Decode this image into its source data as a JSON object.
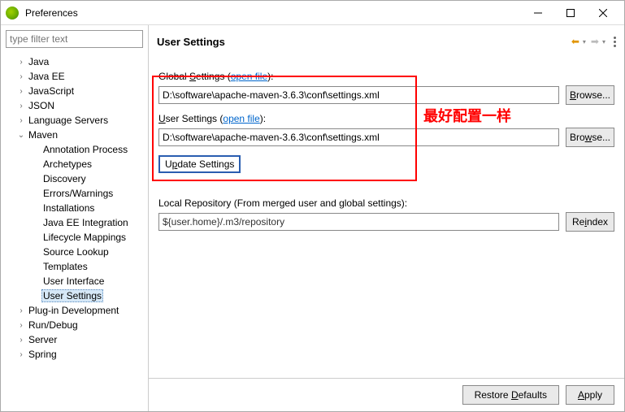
{
  "window": {
    "title": "Preferences"
  },
  "sidebar": {
    "filter_placeholder": "type filter text",
    "items": [
      {
        "label": "Java",
        "expandable": true,
        "expanded": false,
        "indent": 1
      },
      {
        "label": "Java EE",
        "expandable": true,
        "expanded": false,
        "indent": 1
      },
      {
        "label": "JavaScript",
        "expandable": true,
        "expanded": false,
        "indent": 1
      },
      {
        "label": "JSON",
        "expandable": true,
        "expanded": false,
        "indent": 1
      },
      {
        "label": "Language Servers",
        "expandable": true,
        "expanded": false,
        "indent": 1
      },
      {
        "label": "Maven",
        "expandable": true,
        "expanded": true,
        "indent": 1
      },
      {
        "label": "Annotation Process",
        "expandable": false,
        "indent": 2
      },
      {
        "label": "Archetypes",
        "expandable": false,
        "indent": 2
      },
      {
        "label": "Discovery",
        "expandable": false,
        "indent": 2
      },
      {
        "label": "Errors/Warnings",
        "expandable": false,
        "indent": 2
      },
      {
        "label": "Installations",
        "expandable": false,
        "indent": 2
      },
      {
        "label": "Java EE Integration",
        "expandable": false,
        "indent": 2
      },
      {
        "label": "Lifecycle Mappings",
        "expandable": false,
        "indent": 2
      },
      {
        "label": "Source Lookup",
        "expandable": false,
        "indent": 2
      },
      {
        "label": "Templates",
        "expandable": false,
        "indent": 2
      },
      {
        "label": "User Interface",
        "expandable": false,
        "indent": 2
      },
      {
        "label": "User Settings",
        "expandable": false,
        "indent": 2,
        "selected": true
      },
      {
        "label": "Plug-in Development",
        "expandable": true,
        "expanded": false,
        "indent": 1
      },
      {
        "label": "Run/Debug",
        "expandable": true,
        "expanded": false,
        "indent": 1
      },
      {
        "label": "Server",
        "expandable": true,
        "expanded": false,
        "indent": 1
      },
      {
        "label": "Spring",
        "expandable": true,
        "expanded": false,
        "indent": 1
      }
    ]
  },
  "content": {
    "heading": "User Settings",
    "global_settings_label": "Global Settings",
    "open_file_link": "open file",
    "global_settings_value": "D:\\software\\apache-maven-3.6.3\\conf\\settings.xml",
    "user_settings_label": "User Settings",
    "user_settings_value": "D:\\software\\apache-maven-3.6.3\\conf\\settings.xml",
    "browse_label": "Browse...",
    "update_settings_label": "Update Settings",
    "local_repo_label": "Local Repository (From merged user and global settings):",
    "local_repo_value": "${user.home}/.m3/repository",
    "reindex_label": "Reindex",
    "annotation_text": "最好配置一样"
  },
  "footer": {
    "restore_defaults": "Restore Defaults",
    "apply": "Apply"
  }
}
